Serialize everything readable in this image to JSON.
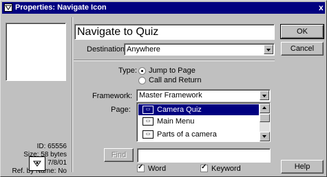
{
  "window": {
    "title": "Properties: Navigate Icon",
    "close_label": "x"
  },
  "info": {
    "id": "ID: 65556",
    "size": "Size: 58 bytes",
    "mod": "Mod: 7/8/01",
    "ref": "Ref. by Name: No"
  },
  "icon_title": "Navigate to Quiz",
  "destination": {
    "label": "Destination:",
    "value": "Anywhere"
  },
  "type": {
    "label": "Type:",
    "options": [
      "Jump to Page",
      "Call and Return"
    ],
    "selected": "Jump to Page"
  },
  "framework": {
    "label": "Framework:",
    "value": "Master Framework"
  },
  "page": {
    "label": "Page:",
    "items": [
      {
        "label": "Camera Quiz",
        "icon": "page-icon",
        "selected": true
      },
      {
        "label": "Main Menu",
        "icon": "page-icon",
        "selected": false
      },
      {
        "label": "Parts of a camera",
        "icon": "page-icon",
        "selected": false
      }
    ]
  },
  "find": {
    "button_label": "Find",
    "value": ""
  },
  "options": {
    "word_label": "Word",
    "word_checked": true,
    "keyword_label": "Keyword",
    "keyword_checked": true
  },
  "buttons": {
    "ok": "OK",
    "cancel": "Cancel",
    "help": "Help"
  }
}
